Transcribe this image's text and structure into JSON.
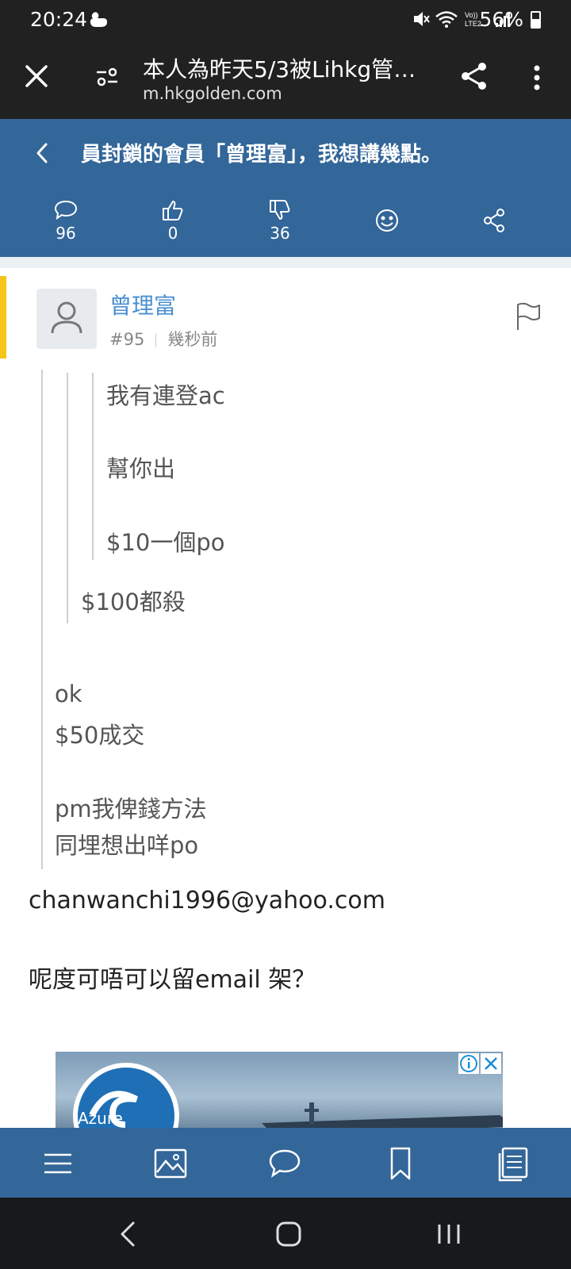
{
  "status_bar": {
    "time": "20:24",
    "battery": "56%",
    "icons": [
      "duck-icon",
      "mute-icon",
      "wifi-icon",
      "volte-icon",
      "signal-icon",
      "battery-icon"
    ],
    "volte_label": "Vo)) LTE2"
  },
  "browser": {
    "title": "本人為昨天5/3被Lihkg管理...",
    "url": "m.hkgolden.com",
    "icons": [
      "close-icon",
      "tune-icon",
      "share-icon",
      "more-vert-icon"
    ]
  },
  "topic": {
    "title": "員封鎖的會員「曾理富」，我想講幾點。",
    "replies": "96",
    "likes": "0",
    "dislikes": "36"
  },
  "post": {
    "author": "曾理富",
    "number": "#95",
    "time": "幾秒前",
    "quote_inner": [
      "我有連登ac",
      "幫你出",
      "$10一個po"
    ],
    "quote_mid": "$100都殺",
    "quote_outer": [
      "ok",
      "$50成交",
      "pm我俾錢方法",
      "同埋想出咩po"
    ],
    "body": [
      "chanwanchi1996@yahoo.com",
      "呢度可唔可以留email 架？"
    ]
  },
  "ad": {
    "brand_text": "Azure"
  },
  "colors": {
    "header_blue": "#336699",
    "author_blue": "#4a8fd0",
    "accent_yellow": "#f5c518",
    "dark_bar": "#212121"
  }
}
